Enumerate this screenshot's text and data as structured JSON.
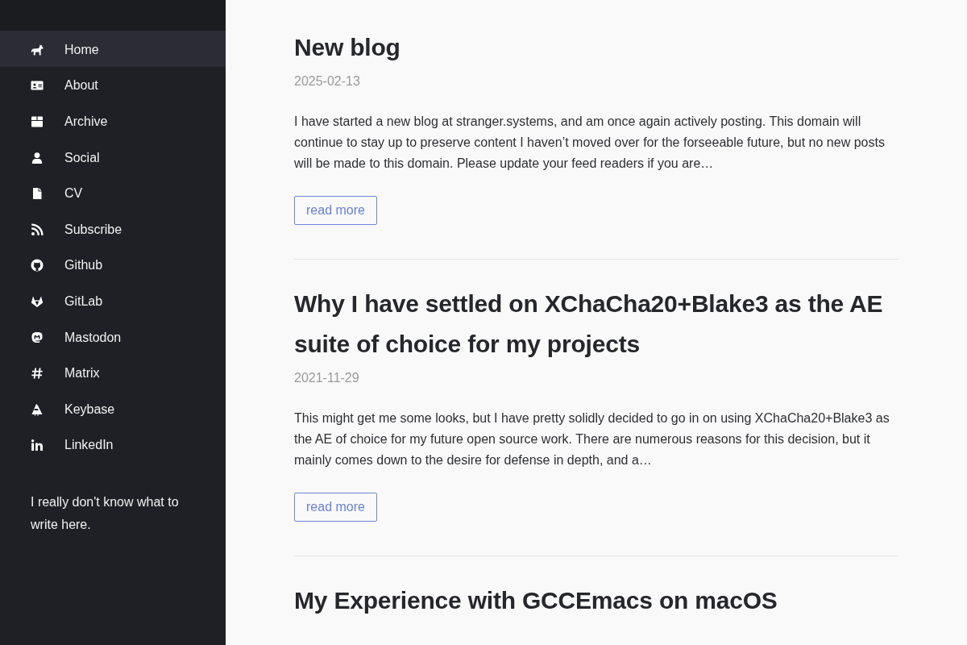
{
  "sidebar": {
    "nav": [
      {
        "label": "Home",
        "selected": true
      },
      {
        "label": "About",
        "selected": false
      },
      {
        "label": "Archive",
        "selected": false
      },
      {
        "label": "Social",
        "selected": false
      },
      {
        "label": "CV",
        "selected": false
      },
      {
        "label": "Subscribe",
        "selected": false
      },
      {
        "label": "Github",
        "selected": false
      },
      {
        "label": "GitLab",
        "selected": false
      },
      {
        "label": "Mastodon",
        "selected": false
      },
      {
        "label": "Matrix",
        "selected": false
      },
      {
        "label": "Keybase",
        "selected": false
      },
      {
        "label": "LinkedIn",
        "selected": false
      }
    ],
    "blurb": "I really don't know what to write here."
  },
  "posts": [
    {
      "title": "New blog",
      "date": "2025-02-13",
      "excerpt": "I have started a new blog at stranger.systems, and am once again actively posting. This domain will continue to stay up to preserve content I haven’t moved over for the forseeable future, but no new posts will be made to this domain. Please update your feed readers if you are…",
      "link": "read more"
    },
    {
      "title": "Why I have settled on XChaCha20+Blake3 as the AE suite of choice for my projects",
      "date": "2021-11-29",
      "excerpt": "This might get me some looks, but I have pretty solidly decided to go in on using XChaCha20+Blake3 as the AE of choice for my future open source work. There are numerous reasons for this decision, but it mainly comes down to the desire for defense in depth, and a…",
      "link": "read more"
    },
    {
      "title": "My Experience with GCCEmacs on macOS"
    }
  ]
}
